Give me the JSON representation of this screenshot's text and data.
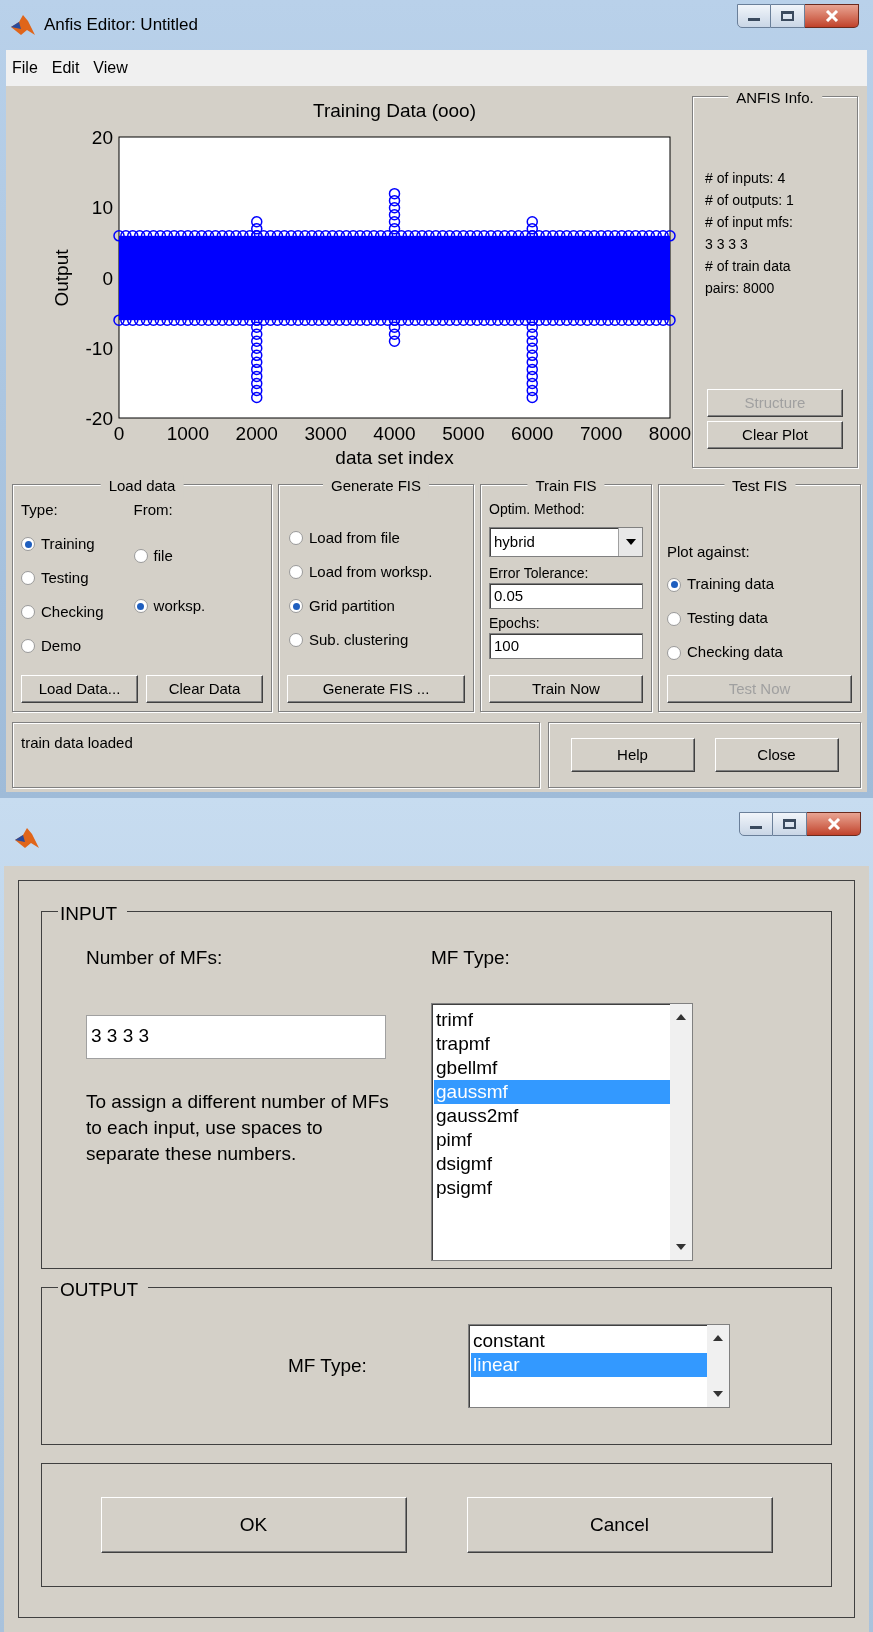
{
  "window": {
    "title": "Anfis Editor: Untitled"
  },
  "menu": [
    "File",
    "Edit",
    "View"
  ],
  "plot": {
    "title": "Training Data (ooo)",
    "ylabel": "Output",
    "xlabel": "data set index",
    "yticks": [
      "20",
      "10",
      "0",
      "-10",
      "-20"
    ],
    "xticks": [
      "0",
      "1000",
      "2000",
      "3000",
      "4000",
      "5000",
      "6000",
      "7000",
      "8000"
    ]
  },
  "anfis_info": {
    "title": "ANFIS Info.",
    "lines": [
      "# of inputs: 4",
      "# of outputs: 1",
      "# of input mfs:",
      "3 3 3 3",
      "# of train data",
      "pairs: 8000"
    ],
    "buttons": [
      {
        "label": "Structure",
        "disabled": true
      },
      {
        "label": "Clear Plot",
        "disabled": false
      }
    ]
  },
  "load_data": {
    "title": "Load data",
    "type_label": "Type:",
    "from_label": "From:",
    "types": [
      {
        "label": "Training",
        "selected": true
      },
      {
        "label": "Testing",
        "selected": false
      },
      {
        "label": "Checking",
        "selected": false
      },
      {
        "label": "Demo",
        "selected": false
      }
    ],
    "sources": [
      {
        "label": "file",
        "selected": false
      },
      {
        "label": "worksp.",
        "selected": true
      }
    ],
    "buttons": [
      "Load Data...",
      "Clear Data"
    ]
  },
  "generate_fis": {
    "title": "Generate FIS",
    "options": [
      {
        "label": "Load from file",
        "selected": false
      },
      {
        "label": "Load from worksp.",
        "selected": false
      },
      {
        "label": "Grid partition",
        "selected": true
      },
      {
        "label": "Sub. clustering",
        "selected": false
      }
    ],
    "button": "Generate FIS ..."
  },
  "train_fis": {
    "title": "Train FIS",
    "method_label": "Optim. Method:",
    "method": "hybrid",
    "tolerance_label": "Error Tolerance:",
    "tolerance": "0.05",
    "epochs_label": "Epochs:",
    "epochs": "100",
    "button": "Train Now"
  },
  "test_fis": {
    "title": "Test FIS",
    "plot_label": "Plot against:",
    "options": [
      {
        "label": "Training data",
        "selected": true
      },
      {
        "label": "Testing data",
        "selected": false
      },
      {
        "label": "Checking data",
        "selected": false
      }
    ],
    "button": {
      "label": "Test Now",
      "disabled": true
    }
  },
  "status": "train data loaded",
  "bottom_buttons": [
    "Help",
    "Close"
  ],
  "dialog": {
    "input": {
      "title": "INPUT",
      "count_label": "Number of MFs:",
      "count": "3 3 3 3",
      "hint": "To assign a different number of MFs to each input, use spaces to separate these numbers.",
      "type_label": "MF Type:",
      "types": [
        {
          "label": "trimf",
          "selected": false
        },
        {
          "label": "trapmf",
          "selected": false
        },
        {
          "label": "gbellmf",
          "selected": false
        },
        {
          "label": "gaussmf",
          "selected": true
        },
        {
          "label": "gauss2mf",
          "selected": false
        },
        {
          "label": "pimf",
          "selected": false
        },
        {
          "label": "dsigmf",
          "selected": false
        },
        {
          "label": "psigmf",
          "selected": false
        }
      ]
    },
    "output": {
      "title": "OUTPUT",
      "type_label": "MF Type:",
      "types": [
        {
          "label": "constant",
          "selected": false
        },
        {
          "label": "linear",
          "selected": true
        }
      ]
    },
    "buttons": [
      "OK",
      "Cancel"
    ]
  }
}
